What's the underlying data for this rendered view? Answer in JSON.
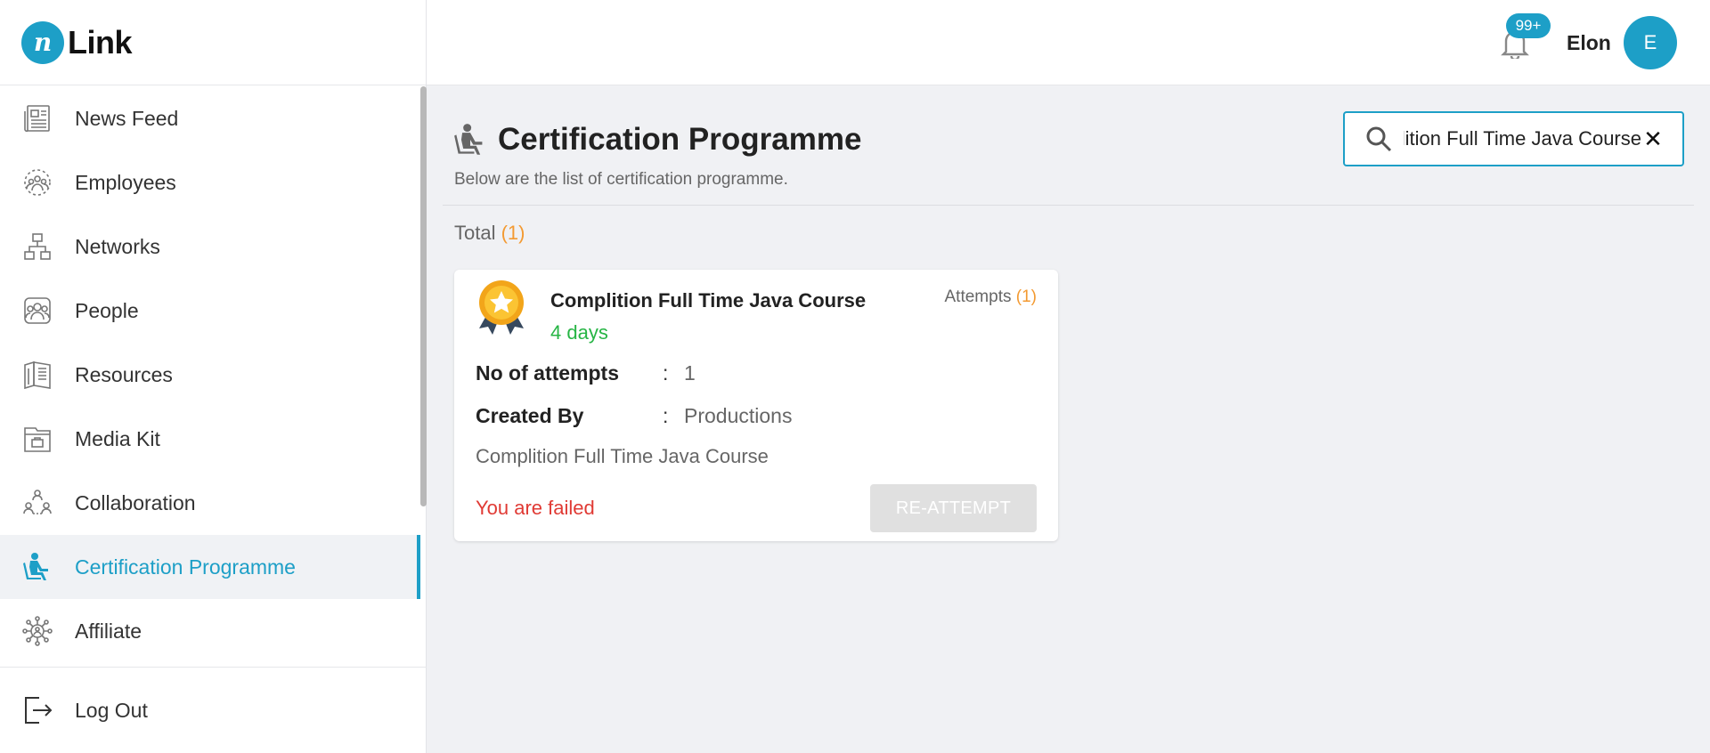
{
  "app": {
    "logo_text": "Link"
  },
  "sidebar": {
    "items": [
      {
        "label": "News Feed",
        "icon": "news-feed-icon"
      },
      {
        "label": "Employees",
        "icon": "employees-icon"
      },
      {
        "label": "Networks",
        "icon": "networks-icon"
      },
      {
        "label": "People",
        "icon": "people-icon"
      },
      {
        "label": "Resources",
        "icon": "resources-icon"
      },
      {
        "label": "Media Kit",
        "icon": "media-kit-icon"
      },
      {
        "label": "Collaboration",
        "icon": "collaboration-icon"
      },
      {
        "label": "Certification Programme",
        "icon": "certification-icon",
        "active": true
      },
      {
        "label": "Affiliate",
        "icon": "affiliate-icon"
      }
    ],
    "logout_label": "Log Out"
  },
  "header": {
    "notification_count": "99+",
    "user_name": "Elon",
    "avatar_initial": "E"
  },
  "main": {
    "title": "Certification Programme",
    "subtitle": "Below are the list of certification programme.",
    "search_value": "Complition Full Time Java Course",
    "total_label": "Total",
    "total_count": "(1)"
  },
  "cards": [
    {
      "title": "Complition Full Time Java Course",
      "duration": "4 days",
      "attempts_label": "Attempts",
      "attempts_count": "(1)",
      "no_of_attempts_label": "No of attempts",
      "no_of_attempts_value": "1",
      "created_by_label": "Created By",
      "created_by_value": "Productions",
      "description": "Complition Full Time Java Course",
      "status": "You are failed",
      "button_label": "RE-ATTEMPT"
    }
  ],
  "colors": {
    "accent": "#1d9fc7",
    "success": "#27b545",
    "danger": "#e03a34",
    "count": "#f39a32"
  }
}
